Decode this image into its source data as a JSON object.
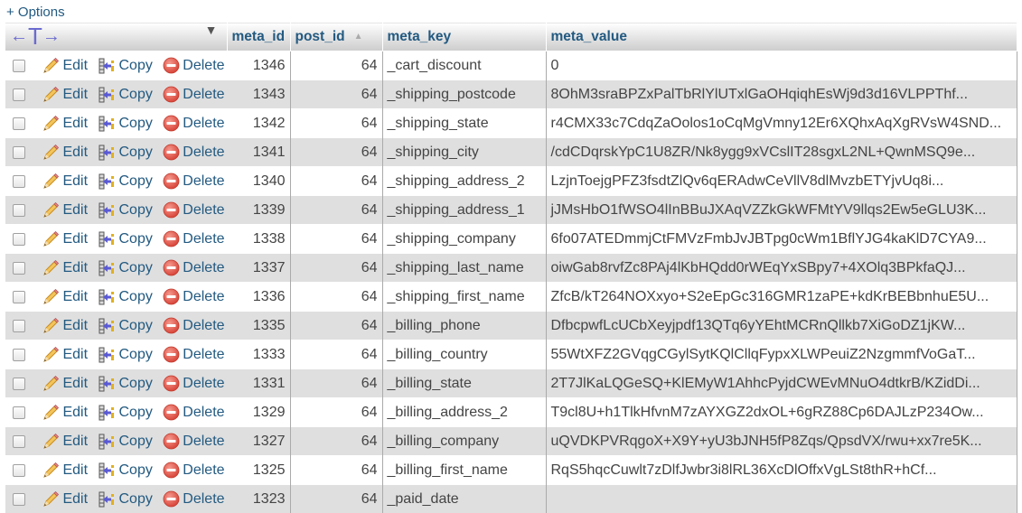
{
  "options_label": "+ Options",
  "table": {
    "columns": [
      {
        "key": "meta_id",
        "label": "meta_id"
      },
      {
        "key": "post_id",
        "label": "post_id",
        "sort": "ascending"
      },
      {
        "key": "meta_key",
        "label": "meta_key"
      },
      {
        "key": "meta_value",
        "label": "meta_value"
      }
    ],
    "actions": {
      "edit": "Edit",
      "copy": "Copy",
      "delete": "Delete"
    },
    "rows": [
      {
        "meta_id": "1346",
        "post_id": "64",
        "meta_key": "_cart_discount",
        "meta_value": "0"
      },
      {
        "meta_id": "1343",
        "post_id": "64",
        "meta_key": "_shipping_postcode",
        "meta_value": "8OhM3sraBPZxPalTbRlYlUTxlGaOHqiqhEsWj9d3d16VLPPThf..."
      },
      {
        "meta_id": "1342",
        "post_id": "64",
        "meta_key": "_shipping_state",
        "meta_value": "r4CMX33c7CdqZaOolos1oCqMgVmny12Er6XQhxAqXgRVsW4SND..."
      },
      {
        "meta_id": "1341",
        "post_id": "64",
        "meta_key": "_shipping_city",
        "meta_value": "/cdCDqrskYpC1U8ZR/Nk8ygg9xVCslIT28sgxL2NL+QwnMSQ9e..."
      },
      {
        "meta_id": "1340",
        "post_id": "64",
        "meta_key": "_shipping_address_2",
        "meta_value": "LzjnToejgPFZ3fsdtZlQv6qERAdwCeVllV8dlMvzbETYjvUq8i..."
      },
      {
        "meta_id": "1339",
        "post_id": "64",
        "meta_key": "_shipping_address_1",
        "meta_value": "jJMsHbO1fWSO4lInBBuJXAqVZZkGkWFMtYV9llqs2Ew5eGLU3K..."
      },
      {
        "meta_id": "1338",
        "post_id": "64",
        "meta_key": "_shipping_company",
        "meta_value": "6fo07ATEDmmjCtFMVzFmbJvJBTpg0cWm1BflYJG4kaKlD7CYA9..."
      },
      {
        "meta_id": "1337",
        "post_id": "64",
        "meta_key": "_shipping_last_name",
        "meta_value": "oiwGab8rvfZc8PAj4lKbHQdd0rWEqYxSBpy7+4XOlq3BPkfaQJ..."
      },
      {
        "meta_id": "1336",
        "post_id": "64",
        "meta_key": "_shipping_first_name",
        "meta_value": "ZfcB/kT264NOXxyo+S2eEpGc316GMR1zaPE+kdKrBEBbnhuE5U..."
      },
      {
        "meta_id": "1335",
        "post_id": "64",
        "meta_key": "_billing_phone",
        "meta_value": "DfbcpwfLcUCbXeyjpdf13QTq6yYEhtMCRnQllkb7XiGoDZ1jKW..."
      },
      {
        "meta_id": "1333",
        "post_id": "64",
        "meta_key": "_billing_country",
        "meta_value": "55WtXFZ2GVqgCGylSytKQlCllqFypxXLWPeuiZ2NzgmmfVoGaT..."
      },
      {
        "meta_id": "1331",
        "post_id": "64",
        "meta_key": "_billing_state",
        "meta_value": "2T7JlKaLQGeSQ+KlEMyW1AhhcPyjdCWEvMNuO4dtkrB/KZidDi..."
      },
      {
        "meta_id": "1329",
        "post_id": "64",
        "meta_key": "_billing_address_2",
        "meta_value": "T9cl8U+h1TlkHfvnM7zAYXGZ2dxOL+6gRZ88Cp6DAJLzP234Ow..."
      },
      {
        "meta_id": "1327",
        "post_id": "64",
        "meta_key": "_billing_company",
        "meta_value": "uQVDKPVRqgoX+X9Y+yU3bJNH5fP8Zqs/QpsdVX/rwu+xx7re5K..."
      },
      {
        "meta_id": "1325",
        "post_id": "64",
        "meta_key": "_billing_first_name",
        "meta_value": "RqS5hqcCuwlt7zDlfJwbr3i8lRL36XcDlOffxVgLSt8thR+hCf..."
      },
      {
        "meta_id": "1323",
        "post_id": "64",
        "meta_key": "_paid_date",
        "meta_value": ""
      }
    ]
  },
  "icons": {
    "column_resize": "left-right-arrows-icon",
    "menu": "dropdown-caret-icon",
    "sort": "sort-ascending-icon",
    "edit": "pencil-icon",
    "copy": "copy-row-icon",
    "delete": "delete-circle-icon"
  },
  "colors": {
    "link": "#235a81",
    "row_even": "#dfdfdf",
    "row_odd": "#ffffff",
    "delete_red": "#e05a4f"
  }
}
